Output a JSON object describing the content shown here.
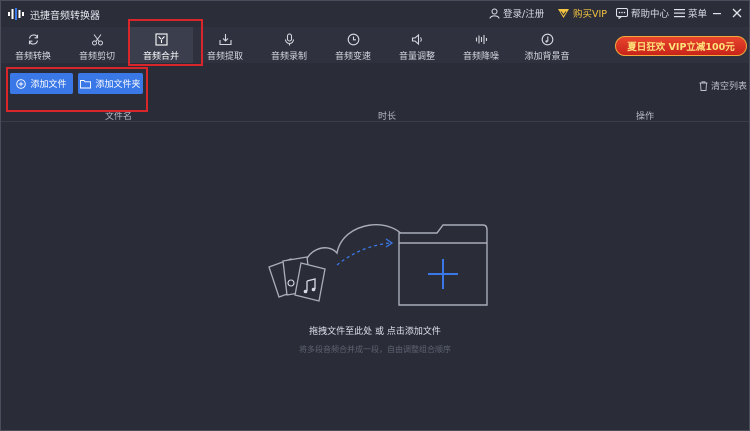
{
  "app": {
    "title": "迅捷音频转换器"
  },
  "titlebar": {
    "login_label": "登录/注册",
    "vip_label": "购买VIP",
    "help_label": "帮助中心",
    "menu_label": "菜单"
  },
  "tabs": [
    {
      "label": "音频转换",
      "icon": "refresh-icon"
    },
    {
      "label": "音频剪切",
      "icon": "scissors-icon"
    },
    {
      "label": "音频合并",
      "icon": "merge-icon",
      "active": true
    },
    {
      "label": "音频提取",
      "icon": "extract-icon"
    },
    {
      "label": "音频录制",
      "icon": "microphone-icon"
    },
    {
      "label": "音频变速",
      "icon": "speed-icon"
    },
    {
      "label": "音量调整",
      "icon": "volume-icon"
    },
    {
      "label": "音频降噪",
      "icon": "noise-reduction-icon"
    },
    {
      "label": "添加背景音",
      "icon": "music-note-icon"
    }
  ],
  "promo": {
    "label": "夏日狂欢 VIP立减100元"
  },
  "toolbar": {
    "add_file_label": "添加文件",
    "add_folder_label": "添加文件夹",
    "clear_list_label": "清空列表"
  },
  "table": {
    "columns": [
      "文件名",
      "时长",
      "操作"
    ]
  },
  "dropzone": {
    "primary_text": "拖拽文件至此处 或 点击添加文件",
    "secondary_text": "将多段音频合并成一段，自由调整组合顺序"
  },
  "colors": {
    "accent": "#3b78e7",
    "highlight_box": "#d8262a",
    "vip": "#f5c342",
    "background": "#2a2d38"
  }
}
